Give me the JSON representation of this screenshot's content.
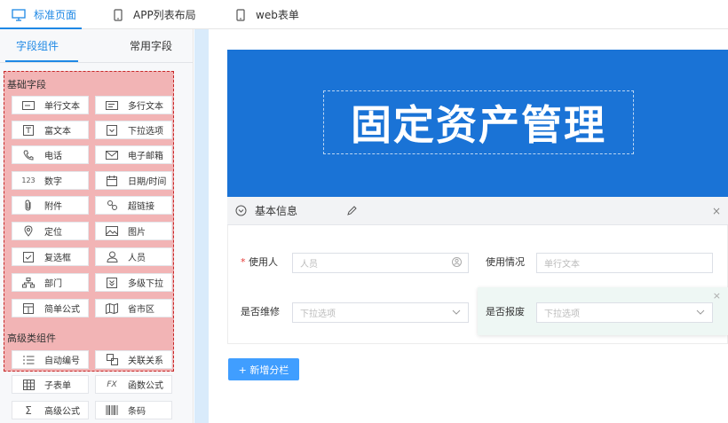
{
  "top_tabs": [
    {
      "label": "标准页面",
      "icon": "monitor-icon",
      "active": true
    },
    {
      "label": "APP列表布局",
      "icon": "phone-icon",
      "active": false
    },
    {
      "label": "web表单",
      "icon": "phone-icon",
      "active": false
    }
  ],
  "left_tabs": [
    {
      "label": "字段组件",
      "active": true
    },
    {
      "label": "常用字段",
      "active": false
    }
  ],
  "groups": {
    "basic": "基础字段",
    "advanced": "高级类组件"
  },
  "fields": {
    "single_text": "单行文本",
    "multi_text": "多行文本",
    "rich_text": "富文本",
    "dropdown": "下拉选项",
    "phone": "电话",
    "email": "电子邮箱",
    "number": "数字",
    "datetime": "日期/时间",
    "attachment": "附件",
    "hyperlink": "超链接",
    "location": "定位",
    "image": "图片",
    "checkbox": "复选框",
    "person": "人员",
    "department": "部门",
    "multi_dropdown": "多级下拉",
    "simple_formula": "简单公式",
    "province_city": "省市区",
    "auto_number": "自动编号",
    "relation": "关联关系",
    "subform": "子表单",
    "function_formula": "函数公式",
    "advanced_formula": "高级公式",
    "barcode": "条码"
  },
  "icons": {
    "fx": "FX",
    "number": "123",
    "sigma": "Σ"
  },
  "banner": {
    "title": "固定资产管理"
  },
  "section": {
    "title": "基本信息"
  },
  "form": {
    "user_label": "使用人",
    "required_mark": "*",
    "user_placeholder": "人员",
    "usage_label": "使用情况",
    "usage_placeholder": "单行文本",
    "repair_label": "是否维修",
    "repair_placeholder": "下拉选项",
    "scrap_label": "是否报废",
    "scrap_placeholder": "下拉选项"
  },
  "add_button": {
    "label": "+ 新增分栏"
  },
  "colors": {
    "accent": "#1e88e5",
    "banner": "#1a73d6",
    "highlight": "#ef7c7c"
  }
}
